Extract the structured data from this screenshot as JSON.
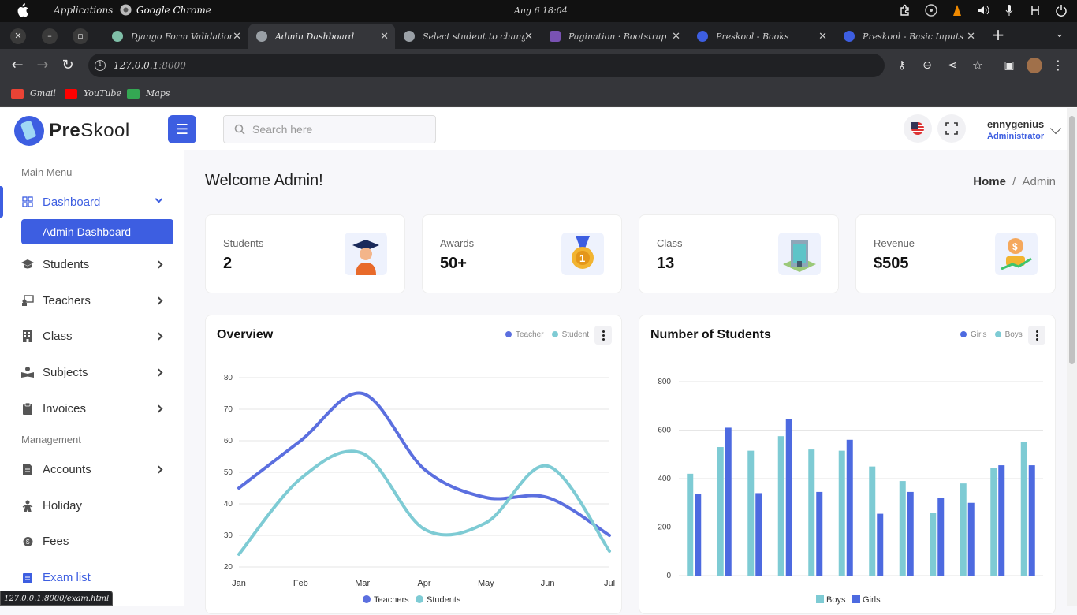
{
  "os": {
    "apps": "Applications",
    "active_app": "Google Chrome",
    "clock": "Aug 6   18:04"
  },
  "browser": {
    "tabs": [
      {
        "title": "Django Form Validation C",
        "favicon_color": "#7fbfa8"
      },
      {
        "title": "Admin Dashboard",
        "favicon_color": "#9aa0a6"
      },
      {
        "title": "Select student to change |",
        "favicon_color": "#9aa0a6"
      },
      {
        "title": "Pagination · Bootstrap",
        "favicon_color": "#7952b3"
      },
      {
        "title": "Preskool - Books",
        "favicon_color": "#3d5ee1"
      },
      {
        "title": "Preskool - Basic Inputs",
        "favicon_color": "#3d5ee1"
      }
    ],
    "url_host": "127.0.0.1",
    "url_port": ":8000",
    "bookmarks": [
      {
        "label": "Gmail",
        "color": "#ea4335"
      },
      {
        "label": "YouTube",
        "color": "#ff0000"
      },
      {
        "label": "Maps",
        "color": "#34a853"
      }
    ],
    "status_url": "127.0.0.1:8000/exam.html"
  },
  "app": {
    "logo": {
      "pre": "Pre",
      "skool": "Skool"
    },
    "search_placeholder": "Search here",
    "user": {
      "name": "ennygenius",
      "role": "Administrator"
    },
    "accent": "#3d5ee1"
  },
  "sidebar": {
    "main_title": "Main Menu",
    "dashboard": "Dashboard",
    "admin_dashboard": "Admin Dashboard",
    "items": [
      "Students",
      "Teachers",
      "Class",
      "Subjects",
      "Invoices"
    ],
    "management_title": "Management",
    "mgmt_items": [
      "Accounts",
      "Holiday",
      "Fees",
      "Exam list"
    ]
  },
  "main": {
    "title": "Welcome Admin!",
    "crumb_home": "Home",
    "crumb_sep": "/",
    "crumb_current": "Admin",
    "stats": [
      {
        "label": "Students",
        "value": "2"
      },
      {
        "label": "Awards",
        "value": "50+"
      },
      {
        "label": "Class",
        "value": "13"
      },
      {
        "label": "Revenue",
        "value": "$505"
      }
    ],
    "overview": {
      "title": "Overview",
      "legend": [
        "Teacher",
        "Student"
      ]
    },
    "students_chart": {
      "title": "Number of Students",
      "legend": [
        "Girls",
        "Boys"
      ]
    }
  },
  "chart_data": [
    {
      "type": "line",
      "title": "Overview",
      "x": [
        "Jan",
        "Feb",
        "Mar",
        "Apr",
        "May",
        "Jun",
        "Jul"
      ],
      "ylim": [
        20,
        80
      ],
      "yticks": [
        20,
        30,
        40,
        50,
        60,
        70,
        80
      ],
      "series": [
        {
          "name": "Teachers",
          "values": [
            45,
            60,
            75,
            51,
            42,
            42,
            30
          ],
          "color": "#5b6fdf"
        },
        {
          "name": "Students",
          "values": [
            24,
            48,
            56,
            32,
            34,
            52,
            25
          ],
          "color": "#7ecbd4"
        }
      ],
      "legend_bottom": [
        "Teachers",
        "Students"
      ]
    },
    {
      "type": "bar",
      "title": "Number of Students",
      "ylim": [
        0,
        800
      ],
      "yticks": [
        0,
        200,
        400,
        600,
        800
      ],
      "series": [
        {
          "name": "Boys",
          "values": [
            420,
            530,
            515,
            575,
            520,
            515,
            450,
            390,
            260,
            380,
            445,
            550
          ],
          "color": "#7ecbd4"
        },
        {
          "name": "Girls",
          "values": [
            335,
            610,
            340,
            645,
            345,
            560,
            255,
            345,
            320,
            300,
            455,
            455
          ],
          "color": "#4d6ae0"
        }
      ],
      "legend_bottom": [
        "Boys",
        "Girls"
      ]
    }
  ]
}
